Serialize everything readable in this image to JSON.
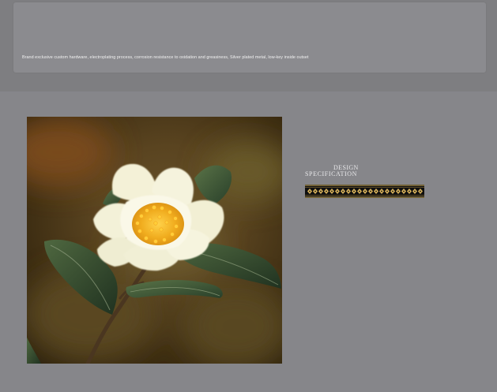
{
  "header": {
    "description": "Brand exclusive custom hardware, electroplating process, corrosion resistance to oxidation and greasiness, Silver plated metal, low-key inside outset"
  },
  "product_image": {
    "subject": "white-camellia-flower-photo"
  },
  "design_spec": {
    "title": "DESIGN",
    "subtitle": "SPECIFICATION",
    "pattern_icon": "ornamental-ribbon-pattern"
  },
  "colors": {
    "page_background": "#86868a",
    "top_band": "#7e7e81",
    "top_panel": "#8b8b8f",
    "ribbon_black": "#111111",
    "ribbon_gold": "#d8b05a"
  }
}
